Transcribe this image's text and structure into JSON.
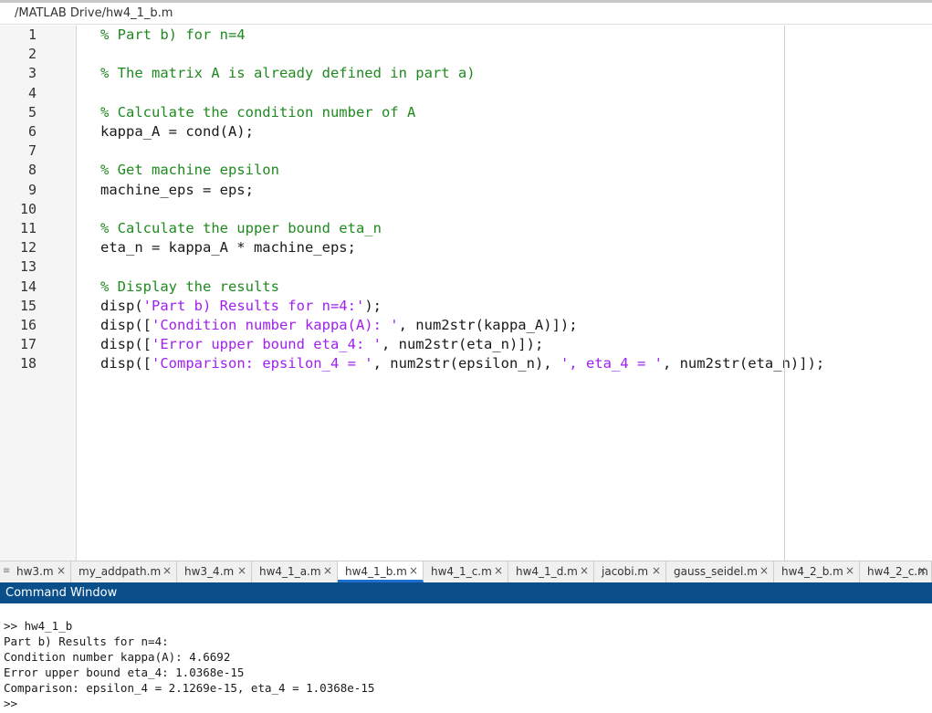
{
  "path": "/MATLAB Drive/hw4_1_b.m",
  "editor": {
    "lines": [
      {
        "n": "1",
        "parts": [
          {
            "t": "comment",
            "s": "% Part b) for n=4"
          }
        ]
      },
      {
        "n": "2",
        "parts": []
      },
      {
        "n": "3",
        "parts": [
          {
            "t": "comment",
            "s": "% The matrix A is already defined in part a)"
          }
        ]
      },
      {
        "n": "4",
        "parts": []
      },
      {
        "n": "5",
        "parts": [
          {
            "t": "comment",
            "s": "% Calculate the condition number of A"
          }
        ]
      },
      {
        "n": "6",
        "parts": [
          {
            "t": "code",
            "s": "kappa_A = cond(A);"
          }
        ]
      },
      {
        "n": "7",
        "parts": []
      },
      {
        "n": "8",
        "parts": [
          {
            "t": "comment",
            "s": "% Get machine epsilon"
          }
        ]
      },
      {
        "n": "9",
        "parts": [
          {
            "t": "code",
            "s": "machine_eps = eps;"
          }
        ]
      },
      {
        "n": "10",
        "parts": []
      },
      {
        "n": "11",
        "parts": [
          {
            "t": "comment",
            "s": "% Calculate the upper bound eta_n"
          }
        ]
      },
      {
        "n": "12",
        "parts": [
          {
            "t": "code",
            "s": "eta_n = kappa_A * machine_eps;"
          }
        ]
      },
      {
        "n": "13",
        "parts": []
      },
      {
        "n": "14",
        "parts": [
          {
            "t": "comment",
            "s": "% Display the results"
          }
        ]
      },
      {
        "n": "15",
        "parts": [
          {
            "t": "code",
            "s": "disp("
          },
          {
            "t": "string",
            "s": "'Part b) Results for n=4:'"
          },
          {
            "t": "code",
            "s": ");"
          }
        ]
      },
      {
        "n": "16",
        "parts": [
          {
            "t": "code",
            "s": "disp(["
          },
          {
            "t": "string",
            "s": "'Condition number kappa(A): '"
          },
          {
            "t": "code",
            "s": ", num2str(kappa_A)]);"
          }
        ]
      },
      {
        "n": "17",
        "parts": [
          {
            "t": "code",
            "s": "disp(["
          },
          {
            "t": "string",
            "s": "'Error upper bound eta_4: '"
          },
          {
            "t": "code",
            "s": ", num2str(eta_n)]);"
          }
        ]
      },
      {
        "n": "18",
        "parts": [
          {
            "t": "code",
            "s": "disp(["
          },
          {
            "t": "string",
            "s": "'Comparison: epsilon_4 = '"
          },
          {
            "t": "code",
            "s": ", num2str(epsilon_n), "
          },
          {
            "t": "string",
            "s": "', eta_4 = '"
          },
          {
            "t": "code",
            "s": ", num2str(eta_n)]);"
          }
        ]
      }
    ]
  },
  "tabs": [
    {
      "label": "hw3.m",
      "active": false
    },
    {
      "label": "my_addpath.m",
      "active": false
    },
    {
      "label": "hw3_4.m",
      "active": false
    },
    {
      "label": "hw4_1_a.m",
      "active": false
    },
    {
      "label": "hw4_1_b.m",
      "active": true
    },
    {
      "label": "hw4_1_c.m",
      "active": false
    },
    {
      "label": "hw4_1_d.m",
      "active": false
    },
    {
      "label": "jacobi.m",
      "active": false
    },
    {
      "label": "gauss_seidel.m",
      "active": false
    },
    {
      "label": "hw4_2_b.m",
      "active": false
    },
    {
      "label": "hw4_2_c.m",
      "active": false
    }
  ],
  "tab_handle_icon": "grip-icon",
  "tab_close_glyph": "×",
  "command_window": {
    "title": "Command Window",
    "lines": [
      ">> hw4_1_b",
      "Part b) Results for n=4:",
      "Condition number kappa(A): 4.6692",
      "Error upper bound eta_4: 1.0368e-15",
      "Comparison: epsilon_4 = 2.1269e-15, eta_4 = 1.0368e-15",
      ">>"
    ]
  },
  "colors": {
    "comment": "#1f8a1f",
    "string": "#a020f0",
    "command_header": "#0b4f8a",
    "active_tab_accent": "#1f6fd1"
  }
}
